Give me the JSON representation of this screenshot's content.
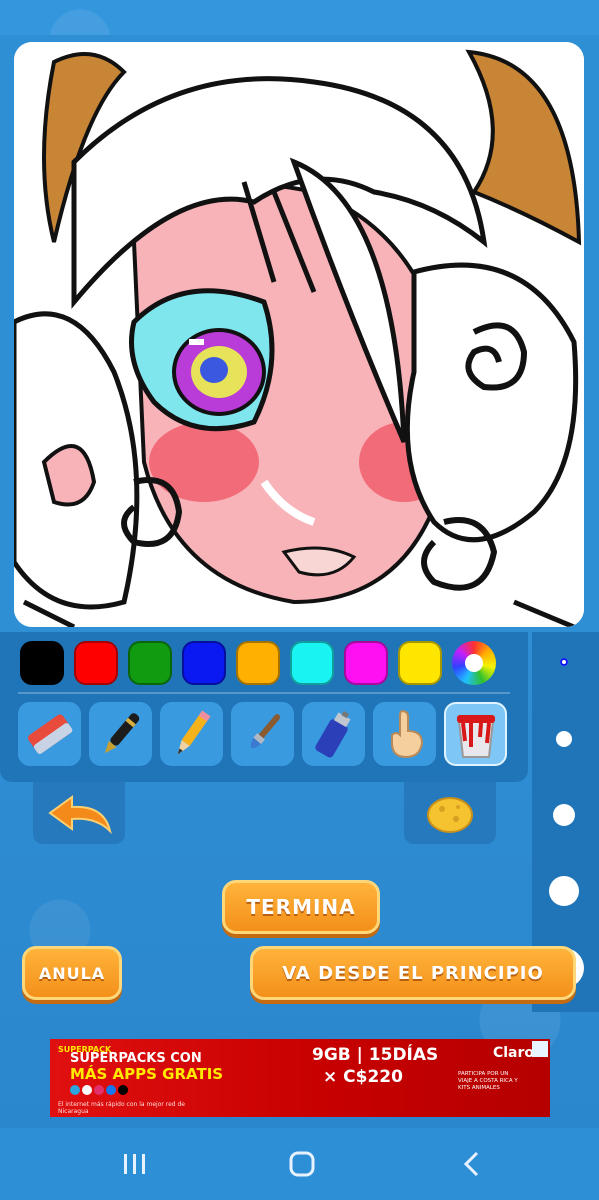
{
  "palette": {
    "colors": [
      "#000000",
      "#ff0000",
      "#119b11",
      "#0a18f2",
      "#ffb000",
      "#19f3f2",
      "#ff10f2",
      "#ffe600"
    ]
  },
  "tools": [
    "eraser-icon",
    "pen-icon",
    "pencil-icon",
    "brush-icon",
    "spray-icon",
    "finger-smudge-icon",
    "paint-bucket-icon"
  ],
  "active_tool": "paint-bucket-icon",
  "buttons": {
    "finish": "TERMINA",
    "undo_all": "ANULA",
    "restart": "VA DESDE EL PRINCIPIO"
  },
  "ad": {
    "brand": "SUPERPACK",
    "line1": "SUPERPACKS CON",
    "line2": "MÁS APPS GRATIS",
    "fine_print": "El internet más rápido con la mejor red de Nicaragua",
    "data": "9GB | 15DÍAS",
    "price": "× C$220",
    "carrier": "Claro",
    "promo": "PARTICIPA POR UN VIAJE A COSTA RICA Y KITS ANIMALES"
  },
  "colors": {
    "accent_orange": "#f7a128",
    "panel_blue": "#1f75b8",
    "background_blue": "#2e8fd6"
  }
}
